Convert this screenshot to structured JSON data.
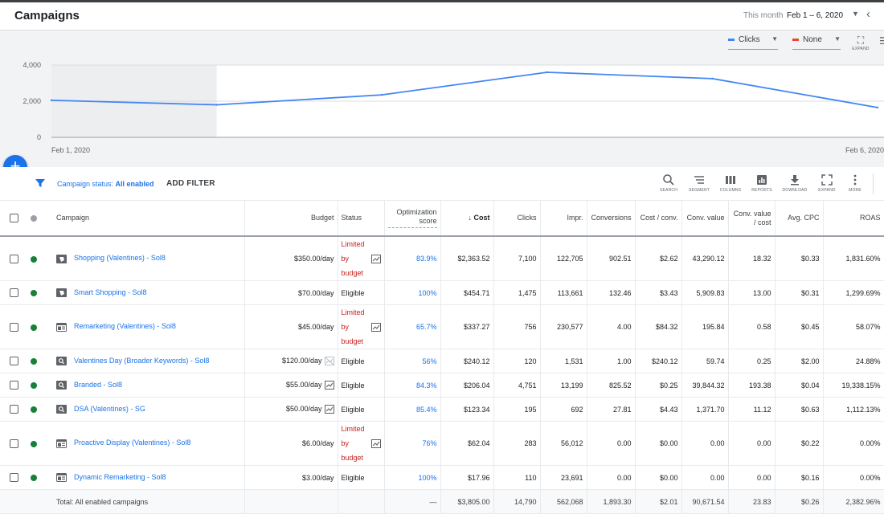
{
  "header": {
    "title": "Campaigns",
    "date_label": "This month",
    "date_range": "Feb 1 – 6, 2020",
    "back_icon": "chevron-left-icon"
  },
  "chart_controls": {
    "metric1": {
      "label": "Clicks",
      "color": "#4285f4"
    },
    "metric2": {
      "label": "None",
      "color": "#ea4335"
    },
    "expand_label": "EXPAND"
  },
  "chart_data": {
    "type": "line",
    "x": [
      "Feb 1, 2020",
      "Feb 2, 2020",
      "Feb 3, 2020",
      "Feb 4, 2020",
      "Feb 5, 2020",
      "Feb 6, 2020"
    ],
    "series": [
      {
        "name": "Clicks",
        "values": [
          2050,
          1800,
          2350,
          3600,
          3250,
          1650
        ]
      }
    ],
    "ylim": [
      0,
      4000
    ],
    "yticks": [
      "0",
      "2,000",
      "4,000"
    ],
    "xtick_labels": [
      "Feb 1, 2020",
      "Feb 6, 2020"
    ],
    "highlight_start": "Feb 1, 2020",
    "highlight_end": "Feb 2, 2020",
    "grid": true
  },
  "filter": {
    "prefix": "Campaign status: ",
    "value": "All enabled",
    "add_filter": "ADD FILTER"
  },
  "toolbar": {
    "search": "SEARCH",
    "segment": "SEGMENT",
    "columns": "COLUMNS",
    "reports": "REPORTS",
    "download": "DOWNLOAD",
    "expand": "EXPAND",
    "more": "MORE"
  },
  "table": {
    "headers": {
      "campaign": "Campaign",
      "budget": "Budget",
      "status": "Status",
      "opt_score": "Optimization score",
      "cost": "Cost",
      "clicks": "Clicks",
      "impr": "Impr.",
      "conversions": "Conversions",
      "cost_conv": "Cost / conv.",
      "conv_value": "Conv. value",
      "conv_value_cost": "Conv. value / cost",
      "avg_cpc": "Avg. CPC",
      "roas": "ROAS"
    },
    "rows": [
      {
        "type": "shopping",
        "name": "Shopping (Valentines) - Sol8",
        "budget": "$350.00/day",
        "budget_icon": "",
        "limited": true,
        "status_lines": [
          "Limited",
          "by",
          "budget"
        ],
        "status": "",
        "opt": "83.9%",
        "cost": "$2,363.52",
        "clicks": "7,100",
        "impr": "122,705",
        "conv": "902.51",
        "cost_conv": "$2.62",
        "conv_value": "43,290.12",
        "conv_value_cost": "18.32",
        "avg_cpc": "$0.33",
        "roas": "1,831.60%"
      },
      {
        "type": "shopping",
        "name": "Smart Shopping - Sol8",
        "budget": "$70.00/day",
        "budget_icon": "",
        "limited": false,
        "status_lines": [],
        "status": "Eligible",
        "opt": "100%",
        "cost": "$454.71",
        "clicks": "1,475",
        "impr": "113,661",
        "conv": "132.46",
        "cost_conv": "$3.43",
        "conv_value": "5,909.83",
        "conv_value_cost": "13.00",
        "avg_cpc": "$0.31",
        "roas": "1,299.69%"
      },
      {
        "type": "display",
        "name": "Remarketing (Valentines) - Sol8",
        "budget": "$45.00/day",
        "budget_icon": "",
        "limited": true,
        "status_lines": [
          "Limited",
          "by",
          "budget"
        ],
        "status": "",
        "opt": "65.7%",
        "cost": "$337.27",
        "clicks": "756",
        "impr": "230,577",
        "conv": "4.00",
        "cost_conv": "$84.32",
        "conv_value": "195.84",
        "conv_value_cost": "0.58",
        "avg_cpc": "$0.45",
        "roas": "58.07%"
      },
      {
        "type": "search",
        "name": "Valentines Day (Broader Keywords) - Sol8",
        "budget": "$120.00/day",
        "budget_icon": "chart-disabled-icon",
        "limited": false,
        "status_lines": [],
        "status": "Eligible",
        "opt": "56%",
        "cost": "$240.12",
        "clicks": "120",
        "impr": "1,531",
        "conv": "1.00",
        "cost_conv": "$240.12",
        "conv_value": "59.74",
        "conv_value_cost": "0.25",
        "avg_cpc": "$2.00",
        "roas": "24.88%"
      },
      {
        "type": "search",
        "name": "Branded - Sol8",
        "budget": "$55.00/day",
        "budget_icon": "trend-chart-icon",
        "limited": false,
        "status_lines": [],
        "status": "Eligible",
        "opt": "84.3%",
        "cost": "$206.04",
        "clicks": "4,751",
        "impr": "13,199",
        "conv": "825.52",
        "cost_conv": "$0.25",
        "conv_value": "39,844.32",
        "conv_value_cost": "193.38",
        "avg_cpc": "$0.04",
        "roas": "19,338.15%"
      },
      {
        "type": "search",
        "name": "DSA (Valentines) - SG",
        "budget": "$50.00/day",
        "budget_icon": "trend-chart-icon",
        "limited": false,
        "status_lines": [],
        "status": "Eligible",
        "opt": "85.4%",
        "cost": "$123.34",
        "clicks": "195",
        "impr": "692",
        "conv": "27.81",
        "cost_conv": "$4.43",
        "conv_value": "1,371.70",
        "conv_value_cost": "11.12",
        "avg_cpc": "$0.63",
        "roas": "1,112.13%"
      },
      {
        "type": "display",
        "name": "Proactive Display (Valentines) - Sol8",
        "budget": "$6.00/day",
        "budget_icon": "",
        "limited": true,
        "status_lines": [
          "Limited",
          "by",
          "budget"
        ],
        "status": "",
        "opt": "76%",
        "cost": "$62.04",
        "clicks": "283",
        "impr": "56,012",
        "conv": "0.00",
        "cost_conv": "$0.00",
        "conv_value": "0.00",
        "conv_value_cost": "0.00",
        "avg_cpc": "$0.22",
        "roas": "0.00%"
      },
      {
        "type": "display",
        "name": "Dynamic Remarketing - Sol8",
        "budget": "$3.00/day",
        "budget_icon": "",
        "limited": false,
        "status_lines": [],
        "status": "Eligible",
        "opt": "100%",
        "cost": "$17.96",
        "clicks": "110",
        "impr": "23,691",
        "conv": "0.00",
        "cost_conv": "$0.00",
        "conv_value": "0.00",
        "conv_value_cost": "0.00",
        "avg_cpc": "$0.16",
        "roas": "0.00%"
      }
    ],
    "total": {
      "label": "Total: All enabled campaigns",
      "opt": "—",
      "cost": "$3,805.00",
      "clicks": "14,790",
      "impr": "562,068",
      "conv": "1,893.30",
      "cost_conv": "$2.01",
      "conv_value": "90,671.54",
      "conv_value_cost": "23.83",
      "avg_cpc": "$0.26",
      "roas": "2,382.96%"
    }
  }
}
